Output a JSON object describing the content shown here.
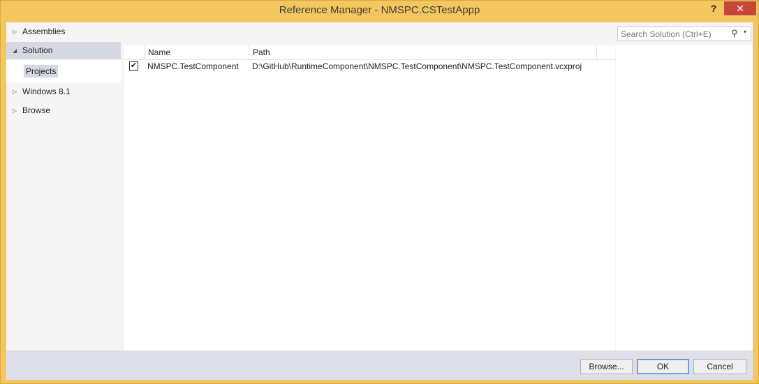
{
  "window": {
    "title": "Reference Manager - NMSPC.CSTestAppp",
    "help_glyph": "?",
    "close_glyph": "✕"
  },
  "nav": {
    "items": [
      {
        "label": "Assemblies",
        "arrow": "▷"
      },
      {
        "label": "Solution",
        "arrow": "◢"
      },
      {
        "label": "Windows 8.1",
        "arrow": "▷"
      },
      {
        "label": "Browse",
        "arrow": "▷"
      }
    ],
    "sub_item": "Projects"
  },
  "list": {
    "columns": [
      "Name",
      "Path"
    ],
    "rows": [
      {
        "checked": true,
        "check_glyph": "✔",
        "name": "NMSPC.TestComponent",
        "path": "D:\\GitHub\\RuntimeComponent\\NMSPC.TestComponent\\NMSPC.TestComponent.vcxproj"
      }
    ]
  },
  "search": {
    "placeholder": "Search Solution (Ctrl+E)",
    "icon": "search-icon",
    "dropdown_glyph": "▾",
    "icon_glyph": "⚲"
  },
  "footer": {
    "browse": "Browse...",
    "ok": "OK",
    "cancel": "Cancel"
  },
  "colors": {
    "frame": "#f3c660",
    "close": "#c7463a",
    "selected": "#d4d9e3"
  }
}
